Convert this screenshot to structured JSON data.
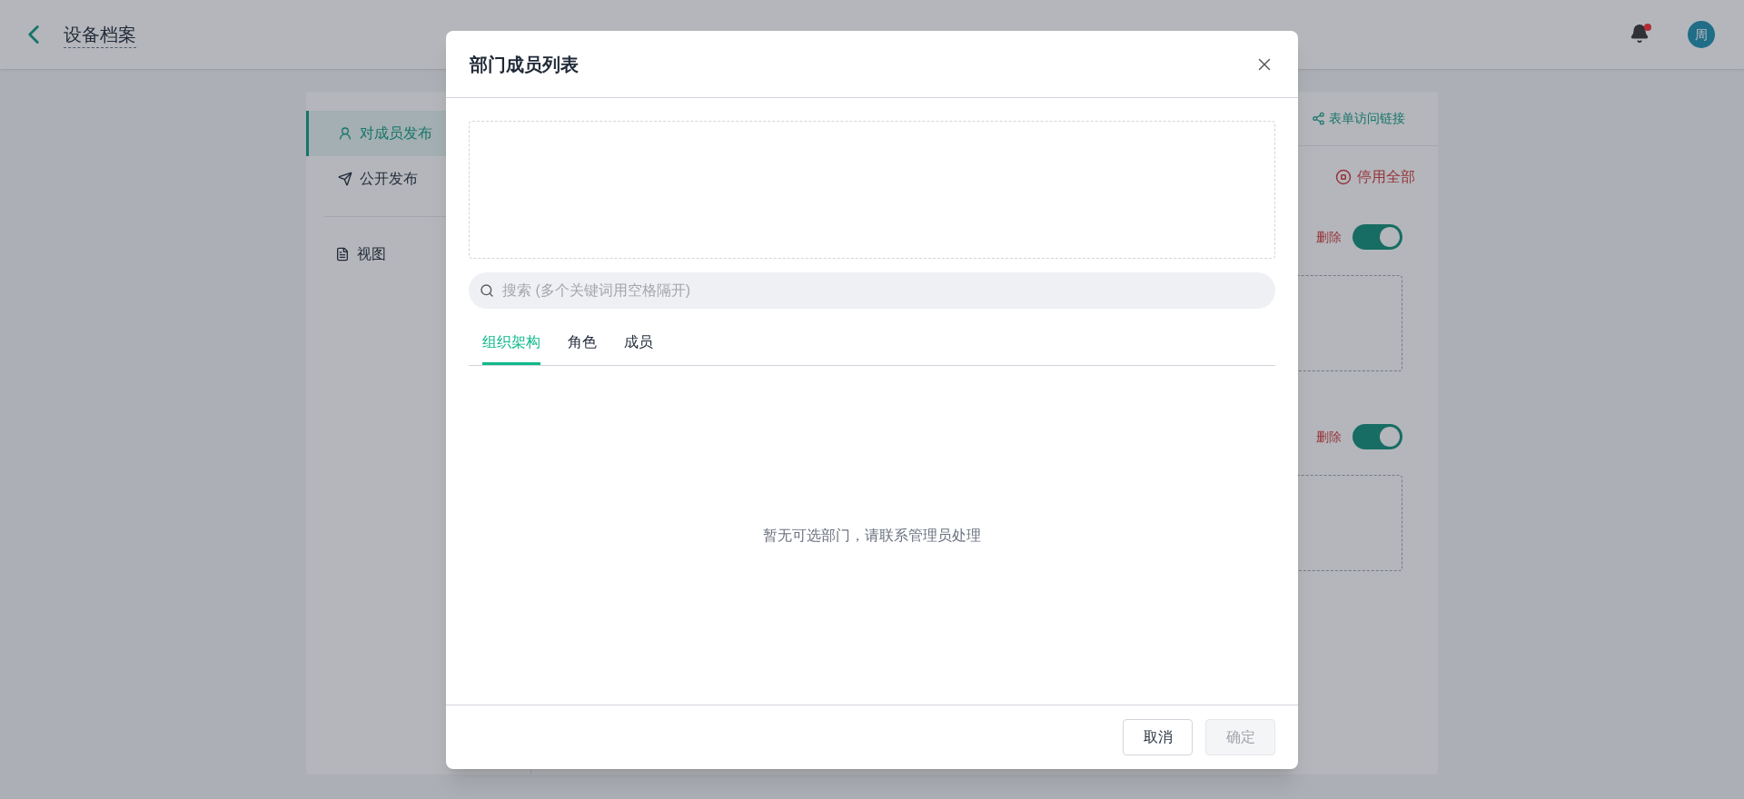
{
  "header": {
    "title": "设备档案",
    "avatar": "周"
  },
  "sidebar": {
    "items": [
      {
        "label": "对成员发布",
        "selected": true
      },
      {
        "label": "公开发布",
        "selected": false
      }
    ],
    "view_item": {
      "label": "视图"
    }
  },
  "toolbar": {
    "link": "表单访问链接"
  },
  "disable_all": "停用全部",
  "sections": [
    {
      "delete": "删除",
      "on": true
    },
    {
      "delete": "删除",
      "on": true
    }
  ],
  "dialog": {
    "title": "部门成员列表",
    "search": {
      "placeholder": "搜索 (多个关键词用空格隔开)"
    },
    "tabs": [
      {
        "label": "组织架构",
        "selected": true
      },
      {
        "label": "角色",
        "selected": false
      },
      {
        "label": "成员",
        "selected": false
      }
    ],
    "empty_text": "暂无可选部门，请联系管理员处理",
    "buttons": [
      {
        "label": "取消",
        "disabled": false
      },
      {
        "label": "确定",
        "disabled": true
      }
    ]
  }
}
